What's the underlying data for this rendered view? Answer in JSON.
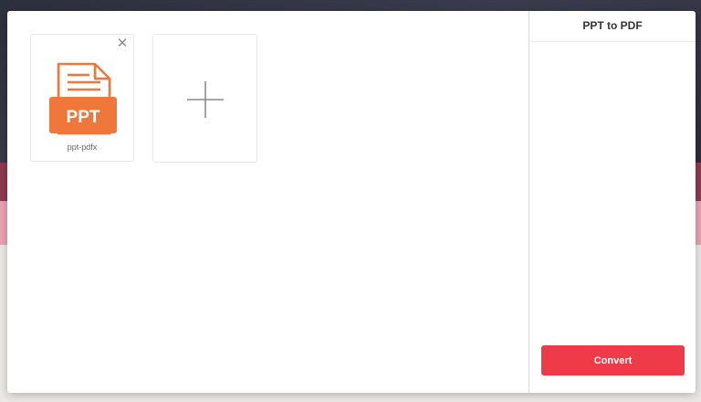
{
  "file_list": {
    "files": [
      {
        "name": "ppt-pdfx",
        "type_label": "PPT",
        "icon": "ppt-file-icon",
        "remove_icon": "close-icon"
      }
    ],
    "add_icon": "plus-icon"
  },
  "panel": {
    "title": "PPT to PDF",
    "convert_label": "Convert"
  },
  "colors": {
    "accent": "#ef3b49",
    "ppt_orange": "#f0773a"
  }
}
